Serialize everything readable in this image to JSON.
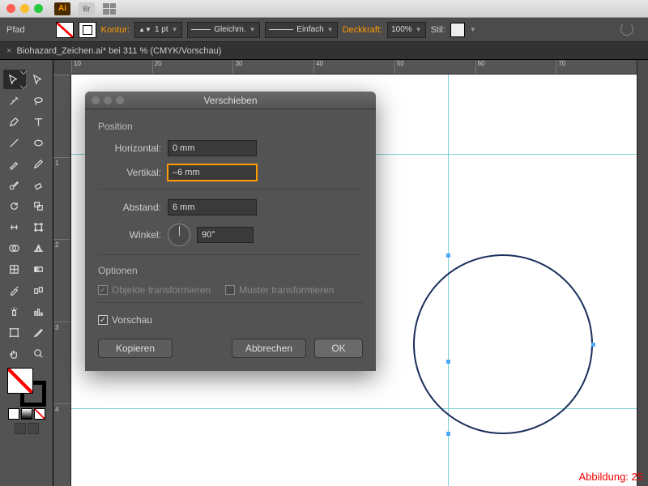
{
  "titlebar": {
    "ai": "Ai",
    "br": "Br"
  },
  "controlbar": {
    "path_label": "Pfad",
    "stroke_label": "Kontur:",
    "stroke_value": "1 pt",
    "cap_label": "Gleichm.",
    "profile_label": "Einfach",
    "opacity_label": "Deckkraft:",
    "opacity_value": "100%",
    "style_label": "Stil:"
  },
  "tab": {
    "close": "×",
    "title": "Biohazard_Zeichen.ai* bei 311 % (CMYK/Vorschau)"
  },
  "ruler_h": [
    "10",
    "20",
    "30",
    "40",
    "50",
    "60",
    "70"
  ],
  "ruler_v": [
    "",
    "1",
    "2",
    "3",
    "4"
  ],
  "dialog": {
    "title": "Verschieben",
    "position": "Position",
    "horizontal_label": "Horizontal:",
    "horizontal_value": "0 mm",
    "vertical_label": "Vertikal:",
    "vertical_value": "–6 mm",
    "distance_label": "Abstand:",
    "distance_value": "6 mm",
    "angle_label": "Winkel:",
    "angle_value": "90°",
    "options": "Optionen",
    "transform_objects": "Objekte transformieren",
    "transform_patterns": "Muster transformieren",
    "preview": "Vorschau",
    "copy": "Kopieren",
    "cancel": "Abbrechen",
    "ok": "OK"
  },
  "caption": "Abbildung: 25"
}
